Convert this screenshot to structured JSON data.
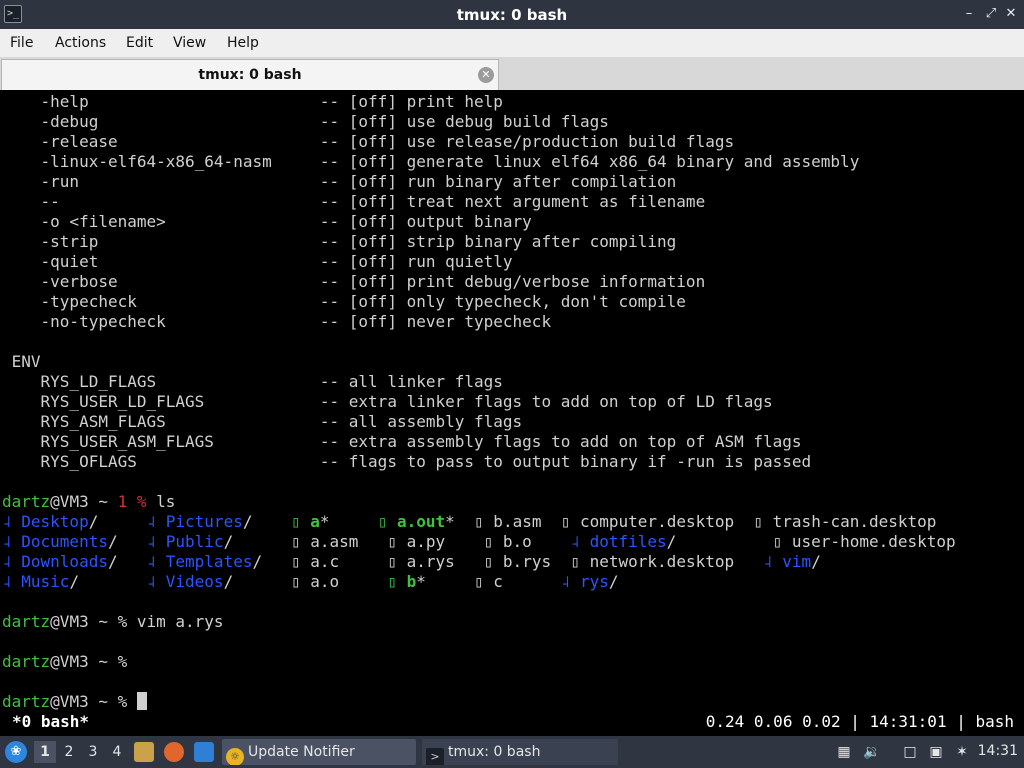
{
  "window": {
    "title": "tmux: 0 bash",
    "app_icon": "terminal-icon",
    "min_symbol": "–",
    "max_symbol": "⤢",
    "close_symbol": "✕"
  },
  "menu": {
    "file": "File",
    "actions": "Actions",
    "edit": "Edit",
    "view": "View",
    "help": "Help"
  },
  "tab": {
    "label": "tmux: 0 bash",
    "close_symbol": "✕"
  },
  "terminal": {
    "lines": [
      [
        {
          "t": "    -help                        -- [off] print help"
        }
      ],
      [
        {
          "t": "    -debug                       -- [off] use debug build flags"
        }
      ],
      [
        {
          "t": "    -release                     -- [off] use release/production build flags"
        }
      ],
      [
        {
          "t": "    -linux-elf64-x86_64-nasm     -- [off] generate linux elf64 x86_64 binary and assembly"
        }
      ],
      [
        {
          "t": "    -run                         -- [off] run binary after compilation"
        }
      ],
      [
        {
          "t": "    --                           -- [off] treat next argument as filename"
        }
      ],
      [
        {
          "t": "    -o <filename>                -- [off] output binary"
        }
      ],
      [
        {
          "t": "    -strip                       -- [off] strip binary after compiling"
        }
      ],
      [
        {
          "t": "    -quiet                       -- [off] run quietly"
        }
      ],
      [
        {
          "t": "    -verbose                     -- [off] print debug/verbose information"
        }
      ],
      [
        {
          "t": "    -typecheck                   -- [off] only typecheck, don't compile"
        }
      ],
      [
        {
          "t": "    -no-typecheck                -- [off] never typecheck"
        }
      ],
      [
        {
          "t": ""
        }
      ],
      [
        {
          "t": " ENV"
        }
      ],
      [
        {
          "t": "    RYS_LD_FLAGS                 -- all linker flags"
        }
      ],
      [
        {
          "t": "    RYS_USER_LD_FLAGS            -- extra linker flags to add on top of LD flags"
        }
      ],
      [
        {
          "t": "    RYS_ASM_FLAGS                -- all assembly flags"
        }
      ],
      [
        {
          "t": "    RYS_USER_ASM_FLAGS           -- extra assembly flags to add on top of ASM flags"
        }
      ],
      [
        {
          "t": "    RYS_OFLAGS                   -- flags to pass to output binary if -run is passed"
        }
      ],
      [
        {
          "t": ""
        }
      ],
      [
        {
          "t": "dartz",
          "c": "g"
        },
        {
          "t": "@VM3 ~ "
        },
        {
          "t": "1",
          "c": "r"
        },
        {
          "t": " "
        },
        {
          "t": "%",
          "c": "r"
        },
        {
          "t": " ls"
        }
      ],
      [
        {
          "t": "˨ ",
          "c": "b"
        },
        {
          "t": "Desktop",
          "c": "b"
        },
        {
          "t": "/     "
        },
        {
          "t": "˨ ",
          "c": "b"
        },
        {
          "t": "Pictures",
          "c": "b"
        },
        {
          "t": "/    "
        },
        {
          "t": "▯ ",
          "c": "g"
        },
        {
          "t": "a",
          "c": "g bold"
        },
        {
          "t": "*     "
        },
        {
          "t": "▯ ",
          "c": "g"
        },
        {
          "t": "a.out",
          "c": "g bold"
        },
        {
          "t": "*  ▯ b.asm  ▯ computer.desktop  ▯ trash-can.desktop"
        }
      ],
      [
        {
          "t": "˨ ",
          "c": "b"
        },
        {
          "t": "Documents",
          "c": "b"
        },
        {
          "t": "/   "
        },
        {
          "t": "˨ ",
          "c": "b"
        },
        {
          "t": "Public",
          "c": "b"
        },
        {
          "t": "/      ▯ a.asm   ▯ a.py    ▯ b.o    "
        },
        {
          "t": "˨ ",
          "c": "b"
        },
        {
          "t": "dotfiles",
          "c": "b"
        },
        {
          "t": "/          ▯ user-home.desktop"
        }
      ],
      [
        {
          "t": "˨ ",
          "c": "b"
        },
        {
          "t": "Downloads",
          "c": "b"
        },
        {
          "t": "/   "
        },
        {
          "t": "˨ ",
          "c": "b"
        },
        {
          "t": "Templates",
          "c": "b"
        },
        {
          "t": "/   ▯ a.c     ▯ a.rys   ▯ b.rys  ▯ network.desktop   "
        },
        {
          "t": "˨ ",
          "c": "b"
        },
        {
          "t": "vim",
          "c": "b"
        },
        {
          "t": "/"
        }
      ],
      [
        {
          "t": "˨ ",
          "c": "b"
        },
        {
          "t": "Music",
          "c": "b"
        },
        {
          "t": "/       "
        },
        {
          "t": "˨ ",
          "c": "b"
        },
        {
          "t": "Videos",
          "c": "b"
        },
        {
          "t": "/      ▯ a.o     "
        },
        {
          "t": "▯ ",
          "c": "g"
        },
        {
          "t": "b",
          "c": "g bold"
        },
        {
          "t": "*     ▯ c      "
        },
        {
          "t": "˨ ",
          "c": "b"
        },
        {
          "t": "rys",
          "c": "b"
        },
        {
          "t": "/"
        }
      ],
      [
        {
          "t": ""
        }
      ],
      [
        {
          "t": "dartz",
          "c": "g"
        },
        {
          "t": "@VM3 ~ % vim a.rys"
        }
      ],
      [
        {
          "t": ""
        }
      ],
      [
        {
          "t": "dartz",
          "c": "g"
        },
        {
          "t": "@VM3 ~ %"
        }
      ],
      [
        {
          "t": ""
        }
      ],
      [
        {
          "t": "dartz",
          "c": "g"
        },
        {
          "t": "@VM3 ~ % "
        },
        {
          "t": "",
          "cursor": true
        }
      ]
    ]
  },
  "tmux_status": {
    "left": "*0 bash*",
    "right": "0.24 0.06 0.02 | 14:31:01 | bash"
  },
  "taskbar": {
    "start_icon": "start-menu-icon",
    "workspaces": [
      "1",
      "2",
      "3",
      "4"
    ],
    "active_workspace": "1",
    "tasks": [
      {
        "label": "Update Notifier",
        "icon": "update-notifier-icon"
      },
      {
        "label": "tmux: 0 bash",
        "icon": "terminal-icon"
      }
    ],
    "clock": "14:31"
  }
}
